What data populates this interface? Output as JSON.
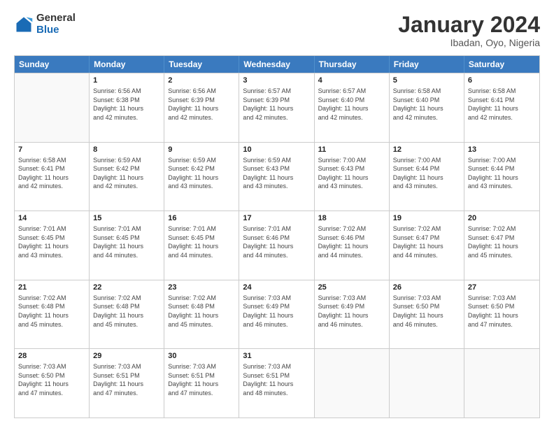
{
  "header": {
    "logo_general": "General",
    "logo_blue": "Blue",
    "main_title": "January 2024",
    "subtitle": "Ibadan, Oyo, Nigeria"
  },
  "days_of_week": [
    "Sunday",
    "Monday",
    "Tuesday",
    "Wednesday",
    "Thursday",
    "Friday",
    "Saturday"
  ],
  "weeks": [
    [
      {
        "day": "",
        "sunrise": "",
        "sunset": "",
        "daylight": ""
      },
      {
        "day": "1",
        "sunrise": "Sunrise: 6:56 AM",
        "sunset": "Sunset: 6:38 PM",
        "daylight": "Daylight: 11 hours and 42 minutes."
      },
      {
        "day": "2",
        "sunrise": "Sunrise: 6:56 AM",
        "sunset": "Sunset: 6:39 PM",
        "daylight": "Daylight: 11 hours and 42 minutes."
      },
      {
        "day": "3",
        "sunrise": "Sunrise: 6:57 AM",
        "sunset": "Sunset: 6:39 PM",
        "daylight": "Daylight: 11 hours and 42 minutes."
      },
      {
        "day": "4",
        "sunrise": "Sunrise: 6:57 AM",
        "sunset": "Sunset: 6:40 PM",
        "daylight": "Daylight: 11 hours and 42 minutes."
      },
      {
        "day": "5",
        "sunrise": "Sunrise: 6:58 AM",
        "sunset": "Sunset: 6:40 PM",
        "daylight": "Daylight: 11 hours and 42 minutes."
      },
      {
        "day": "6",
        "sunrise": "Sunrise: 6:58 AM",
        "sunset": "Sunset: 6:41 PM",
        "daylight": "Daylight: 11 hours and 42 minutes."
      }
    ],
    [
      {
        "day": "7",
        "sunrise": "Sunrise: 6:58 AM",
        "sunset": "Sunset: 6:41 PM",
        "daylight": "Daylight: 11 hours and 42 minutes."
      },
      {
        "day": "8",
        "sunrise": "Sunrise: 6:59 AM",
        "sunset": "Sunset: 6:42 PM",
        "daylight": "Daylight: 11 hours and 42 minutes."
      },
      {
        "day": "9",
        "sunrise": "Sunrise: 6:59 AM",
        "sunset": "Sunset: 6:42 PM",
        "daylight": "Daylight: 11 hours and 43 minutes."
      },
      {
        "day": "10",
        "sunrise": "Sunrise: 6:59 AM",
        "sunset": "Sunset: 6:43 PM",
        "daylight": "Daylight: 11 hours and 43 minutes."
      },
      {
        "day": "11",
        "sunrise": "Sunrise: 7:00 AM",
        "sunset": "Sunset: 6:43 PM",
        "daylight": "Daylight: 11 hours and 43 minutes."
      },
      {
        "day": "12",
        "sunrise": "Sunrise: 7:00 AM",
        "sunset": "Sunset: 6:44 PM",
        "daylight": "Daylight: 11 hours and 43 minutes."
      },
      {
        "day": "13",
        "sunrise": "Sunrise: 7:00 AM",
        "sunset": "Sunset: 6:44 PM",
        "daylight": "Daylight: 11 hours and 43 minutes."
      }
    ],
    [
      {
        "day": "14",
        "sunrise": "Sunrise: 7:01 AM",
        "sunset": "Sunset: 6:45 PM",
        "daylight": "Daylight: 11 hours and 43 minutes."
      },
      {
        "day": "15",
        "sunrise": "Sunrise: 7:01 AM",
        "sunset": "Sunset: 6:45 PM",
        "daylight": "Daylight: 11 hours and 44 minutes."
      },
      {
        "day": "16",
        "sunrise": "Sunrise: 7:01 AM",
        "sunset": "Sunset: 6:45 PM",
        "daylight": "Daylight: 11 hours and 44 minutes."
      },
      {
        "day": "17",
        "sunrise": "Sunrise: 7:01 AM",
        "sunset": "Sunset: 6:46 PM",
        "daylight": "Daylight: 11 hours and 44 minutes."
      },
      {
        "day": "18",
        "sunrise": "Sunrise: 7:02 AM",
        "sunset": "Sunset: 6:46 PM",
        "daylight": "Daylight: 11 hours and 44 minutes."
      },
      {
        "day": "19",
        "sunrise": "Sunrise: 7:02 AM",
        "sunset": "Sunset: 6:47 PM",
        "daylight": "Daylight: 11 hours and 44 minutes."
      },
      {
        "day": "20",
        "sunrise": "Sunrise: 7:02 AM",
        "sunset": "Sunset: 6:47 PM",
        "daylight": "Daylight: 11 hours and 45 minutes."
      }
    ],
    [
      {
        "day": "21",
        "sunrise": "Sunrise: 7:02 AM",
        "sunset": "Sunset: 6:48 PM",
        "daylight": "Daylight: 11 hours and 45 minutes."
      },
      {
        "day": "22",
        "sunrise": "Sunrise: 7:02 AM",
        "sunset": "Sunset: 6:48 PM",
        "daylight": "Daylight: 11 hours and 45 minutes."
      },
      {
        "day": "23",
        "sunrise": "Sunrise: 7:02 AM",
        "sunset": "Sunset: 6:48 PM",
        "daylight": "Daylight: 11 hours and 45 minutes."
      },
      {
        "day": "24",
        "sunrise": "Sunrise: 7:03 AM",
        "sunset": "Sunset: 6:49 PM",
        "daylight": "Daylight: 11 hours and 46 minutes."
      },
      {
        "day": "25",
        "sunrise": "Sunrise: 7:03 AM",
        "sunset": "Sunset: 6:49 PM",
        "daylight": "Daylight: 11 hours and 46 minutes."
      },
      {
        "day": "26",
        "sunrise": "Sunrise: 7:03 AM",
        "sunset": "Sunset: 6:50 PM",
        "daylight": "Daylight: 11 hours and 46 minutes."
      },
      {
        "day": "27",
        "sunrise": "Sunrise: 7:03 AM",
        "sunset": "Sunset: 6:50 PM",
        "daylight": "Daylight: 11 hours and 47 minutes."
      }
    ],
    [
      {
        "day": "28",
        "sunrise": "Sunrise: 7:03 AM",
        "sunset": "Sunset: 6:50 PM",
        "daylight": "Daylight: 11 hours and 47 minutes."
      },
      {
        "day": "29",
        "sunrise": "Sunrise: 7:03 AM",
        "sunset": "Sunset: 6:51 PM",
        "daylight": "Daylight: 11 hours and 47 minutes."
      },
      {
        "day": "30",
        "sunrise": "Sunrise: 7:03 AM",
        "sunset": "Sunset: 6:51 PM",
        "daylight": "Daylight: 11 hours and 47 minutes."
      },
      {
        "day": "31",
        "sunrise": "Sunrise: 7:03 AM",
        "sunset": "Sunset: 6:51 PM",
        "daylight": "Daylight: 11 hours and 48 minutes."
      },
      {
        "day": "",
        "sunrise": "",
        "sunset": "",
        "daylight": ""
      },
      {
        "day": "",
        "sunrise": "",
        "sunset": "",
        "daylight": ""
      },
      {
        "day": "",
        "sunrise": "",
        "sunset": "",
        "daylight": ""
      }
    ]
  ]
}
